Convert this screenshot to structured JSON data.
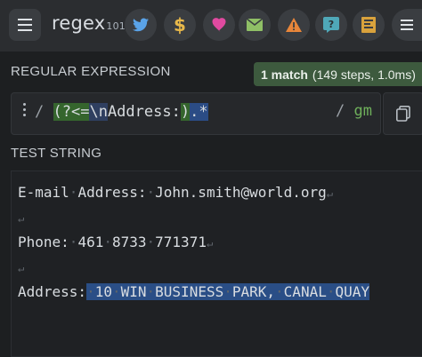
{
  "app": {
    "brand_main": "regex",
    "brand_sub": "101"
  },
  "toolbar_icons": [
    "twitter-icon",
    "dollar-icon",
    "heart-icon",
    "mail-icon",
    "warning-icon",
    "help-icon",
    "book-icon"
  ],
  "regex_section": {
    "title": "REGULAR EXPRESSION",
    "match_count": "1 match",
    "match_detail": "(149 steps, 1.0ms)",
    "open_delimiter": "/",
    "close_delimiter": "/",
    "flags": "gm",
    "pattern_parts": {
      "group_open": "(?<=",
      "escape": "\\n",
      "literal": "Address:",
      "group_close": ")",
      "dot_star": ".*"
    }
  },
  "test_section": {
    "title": "TEST STRING",
    "lines": [
      {
        "before": "E-mail·Address:·John.smith@world.org",
        "newline": "↵"
      },
      {
        "before": "",
        "newline": "↵"
      },
      {
        "before": "Phone:·461·8733·771371",
        "newline": "↵"
      },
      {
        "before": "",
        "newline": "↵"
      },
      {
        "before": "Address:",
        "match": "·10·WIN·BUSINESS·PARK,·CANAL·QUAY"
      }
    ]
  },
  "colors": {
    "group_highlight": "#35652d",
    "escape_highlight": "#2f3f60",
    "match_highlight": "#2a4e86",
    "flag_color": "#6fb05b",
    "badge_bg": "#3d5a3e"
  }
}
